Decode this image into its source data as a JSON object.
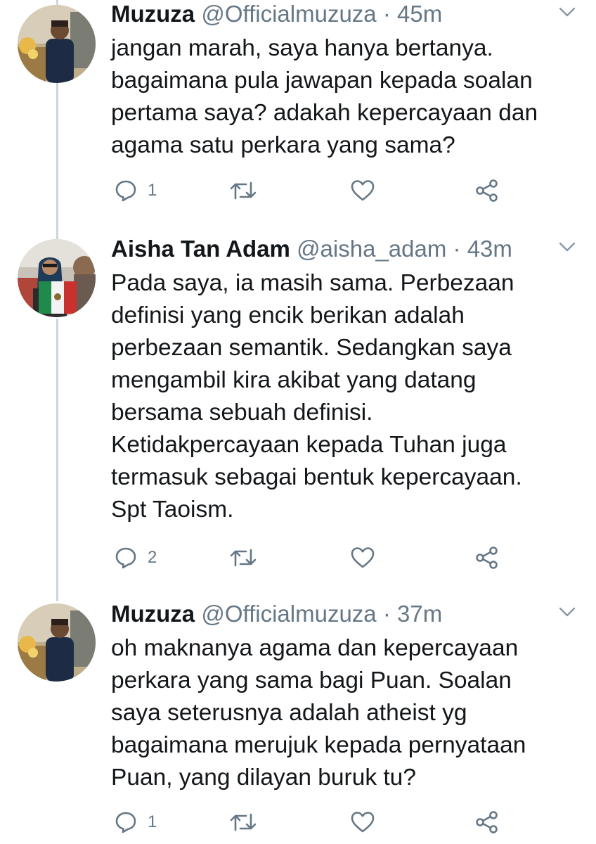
{
  "tweets": [
    {
      "name": "Muzuza",
      "handle": "@Officialmuzuza",
      "separator": "·",
      "time": "45m",
      "avatar": "avatar-muzuza",
      "lines": [
        "jangan marah, saya hanya bertanya.",
        "bagaimana pula jawapan kepada soalan",
        "pertama saya? adakah kepercayaan dan",
        "agama satu perkara yang sama?"
      ],
      "reply_count": "1"
    },
    {
      "name": "Aisha Tan Adam",
      "handle": "@aisha_adam",
      "separator": "·",
      "time": "43m",
      "avatar": "avatar-aisha",
      "lines": [
        "Pada saya, ia masih sama. Perbezaan",
        "definisi yang encik berikan adalah",
        "perbezaan semantik. Sedangkan saya",
        "mengambil kira akibat yang datang",
        "bersama sebuah definisi.",
        "Ketidakpercayaan kepada Tuhan juga",
        "termasuk sebagai bentuk kepercayaan.",
        "Spt Taoism."
      ],
      "reply_count": "2"
    },
    {
      "name": "Muzuza",
      "handle": "@Officialmuzuza",
      "separator": "·",
      "time": "37m",
      "avatar": "avatar-muzuza",
      "lines": [
        "oh maknanya agama dan kepercayaan",
        "perkara yang sama bagi Puan. Soalan",
        "saya seterusnya adalah atheist yg",
        "bagaimana merujuk kepada pernyataan",
        "Puan, yang dilayan buruk tu?"
      ],
      "reply_count": "1"
    }
  ],
  "icons": {
    "reply": "reply-icon",
    "retweet": "retweet-icon",
    "like": "like-icon",
    "share": "share-icon",
    "more": "chevron-down-icon"
  },
  "colors": {
    "text": "#14171a",
    "secondary": "#657786",
    "thread_line": "#ccd6dd"
  }
}
